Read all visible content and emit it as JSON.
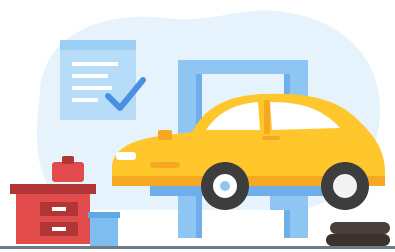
{
  "illustration": {
    "subject": "car-on-service-lift",
    "colors": {
      "backdrop": "#e6f3fc",
      "clipboard": "#b7dcf8",
      "clipboard_lines": "#ffffff",
      "checkmark": "#4a90e2",
      "lift": "#8fc5f3",
      "lift_shadow": "#6faee8",
      "car_body": "#ffc72c",
      "car_shade": "#f7a823",
      "car_window": "#ffffff",
      "tire": "#3d3d3d",
      "hubcap": "#ffffff",
      "toolbox_red": "#e14b4b",
      "toolbox_dark": "#b23535",
      "box_blue": "#7dbdf0",
      "tire_stack": "#4a3f3a",
      "floor": "#6e7a86"
    }
  }
}
